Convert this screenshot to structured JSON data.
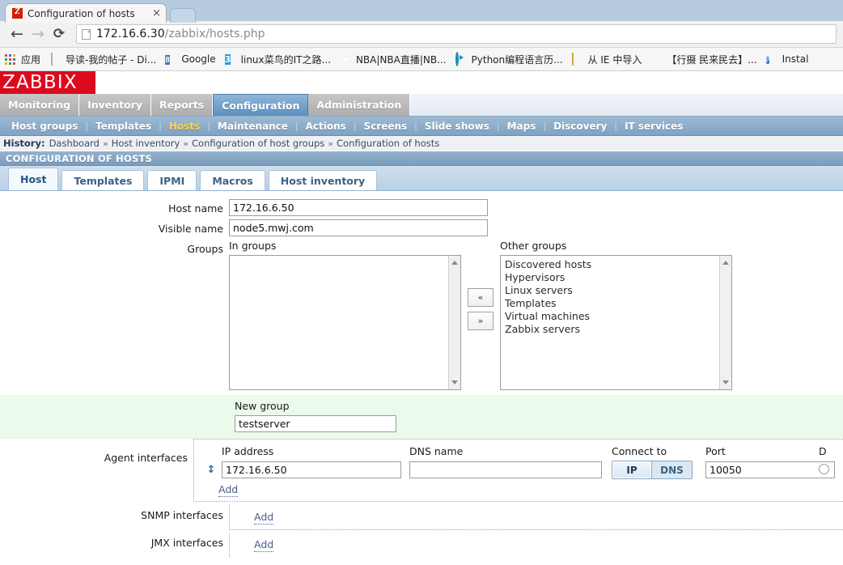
{
  "browser": {
    "tab": {
      "title": "Configuration of hosts",
      "favicon": "zabbix-z-icon",
      "close": "×"
    },
    "nav": {
      "back": "←",
      "forward": "→",
      "reload": "⟳"
    },
    "omnibox": {
      "host": "172.16.6.30",
      "path": "/zabbix/hosts.php"
    },
    "bookmarks": [
      {
        "label": "应用",
        "icon": "apps-grid-icon"
      },
      {
        "label": "导读-我的帖子 - Di...",
        "icon": "document-icon"
      },
      {
        "label": "Google",
        "icon": "google-icon"
      },
      {
        "label": "linux菜鸟的IT之路...",
        "icon": "blog-icon"
      },
      {
        "label": "NBA|NBA直播|NB...",
        "icon": "nba-icon"
      },
      {
        "label": "Python编程语言历...",
        "icon": "python-play-icon"
      },
      {
        "label": "从 IE 中导入",
        "icon": "folder-icon"
      },
      {
        "label": "【行摄 民来民去】...",
        "icon": "hand-icon"
      },
      {
        "label": "Instal",
        "icon": "install-icon"
      }
    ]
  },
  "zabbix": {
    "logo": "ZABBIX",
    "main_menu": [
      {
        "label": "Monitoring",
        "active": false
      },
      {
        "label": "Inventory",
        "active": false
      },
      {
        "label": "Reports",
        "active": false
      },
      {
        "label": "Configuration",
        "active": true
      },
      {
        "label": "Administration",
        "active": false
      }
    ],
    "sub_menu": [
      {
        "label": "Host groups",
        "active": false
      },
      {
        "label": "Templates",
        "active": false
      },
      {
        "label": "Hosts",
        "active": true
      },
      {
        "label": "Maintenance",
        "active": false
      },
      {
        "label": "Actions",
        "active": false
      },
      {
        "label": "Screens",
        "active": false
      },
      {
        "label": "Slide shows",
        "active": false
      },
      {
        "label": "Maps",
        "active": false
      },
      {
        "label": "Discovery",
        "active": false
      },
      {
        "label": "IT services",
        "active": false
      }
    ],
    "history": {
      "label": "History:",
      "items": [
        "Dashboard",
        "Host inventory",
        "Configuration of host groups",
        "Configuration of hosts"
      ],
      "separator": "»"
    },
    "page_title": "CONFIGURATION OF HOSTS",
    "form_tabs": [
      {
        "label": "Host",
        "selected": true
      },
      {
        "label": "Templates",
        "selected": false
      },
      {
        "label": "IPMI",
        "selected": false
      },
      {
        "label": "Macros",
        "selected": false
      },
      {
        "label": "Host inventory",
        "selected": false
      }
    ]
  },
  "form": {
    "host_name": {
      "label": "Host name",
      "value": "172.16.6.50"
    },
    "visible_name": {
      "label": "Visible name",
      "value": "node5.mwj.com"
    },
    "groups": {
      "label": "Groups",
      "in_groups_header": "In groups",
      "in_groups": [],
      "other_groups_header": "Other groups",
      "other_groups": [
        "Discovered hosts",
        "Hypervisors",
        "Linux servers",
        "Templates",
        "Virtual machines",
        "Zabbix servers"
      ],
      "move_left": "«",
      "move_right": "»"
    },
    "new_group": {
      "label": "New group",
      "value": "testserver"
    },
    "agent_interfaces": {
      "label": "Agent interfaces",
      "headers": {
        "ip": "IP address",
        "dns": "DNS name",
        "connect": "Connect to",
        "port": "Port",
        "default": "D"
      },
      "rows": [
        {
          "ip": "172.16.6.50",
          "dns": "",
          "connect_to": "IP",
          "connect_options": [
            "IP",
            "DNS"
          ],
          "port": "10050"
        }
      ],
      "add": "Add",
      "drag": "↕"
    },
    "snmp_interfaces": {
      "label": "SNMP interfaces",
      "add": "Add"
    },
    "jmx_interfaces": {
      "label": "JMX interfaces",
      "add": "Add"
    }
  },
  "colors": {
    "zabbix_red": "#dc0a1e",
    "active_tab_blue": "#5d8fc0",
    "submenu_active": "#ffd34d",
    "newgroup_band": "#ebfaeb"
  }
}
